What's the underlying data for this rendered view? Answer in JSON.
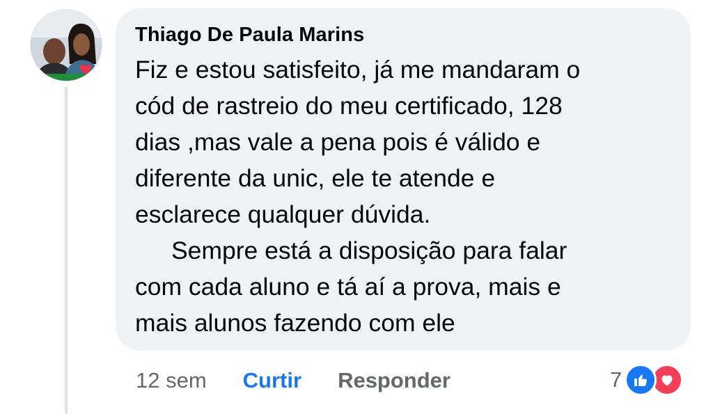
{
  "comment": {
    "author": "Thiago De Paula Marins",
    "paragraphs": [
      "Fiz e estou satisfeito, já me mandaram o cód de rastreio do meu certificado, 128 dias ,mas vale a pena pois é válido e diferente da unic, ele te atende e esclarece qualquer dúvida.",
      "Sempre está a disposição para falar com cada aluno e tá aí a prova, mais e mais alunos fazendo com ele"
    ],
    "lines": [
      "Fiz e estou satisfeito, já me mandaram o",
      "cód de rastreio do meu certificado, 128",
      "dias ,mas vale a pena pois é válido e",
      "diferente da unic, ele te atende e",
      "esclarece qualquer dúvida.",
      "Sempre está a disposição para falar",
      "com cada aluno e tá aí a prova, mais e",
      "mais alunos fazendo com ele"
    ]
  },
  "actions": {
    "time": "12 sem",
    "like_label": "Curtir",
    "reply_label": "Responder"
  },
  "reactions": {
    "count": "7",
    "types": [
      "like-icon",
      "love-icon"
    ],
    "like_color": "#1877f2",
    "love_color": "#f33e58"
  },
  "colors": {
    "bubble": "#f0f2f5",
    "text": "#050505",
    "secondary": "#65676b",
    "accent": "#1877f2"
  }
}
